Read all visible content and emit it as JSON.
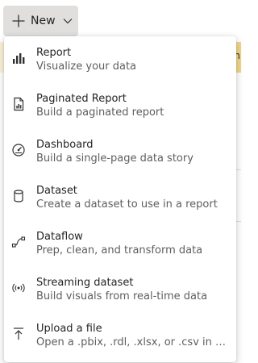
{
  "new_button": {
    "label": "New",
    "plus_icon": "plus-icon",
    "chevron_icon": "chevron-down-icon"
  },
  "background": {
    "banner_fragment": "n"
  },
  "menu": {
    "items": [
      {
        "title": "Report",
        "description": "Visualize your data",
        "icon": "bar-chart-icon"
      },
      {
        "title": "Paginated Report",
        "description": "Build a paginated report",
        "icon": "paginated-report-icon"
      },
      {
        "title": "Dashboard",
        "description": "Build a single-page data story",
        "icon": "dashboard-gauge-icon"
      },
      {
        "title": "Dataset",
        "description": "Create a dataset to use in a report",
        "icon": "database-icon"
      },
      {
        "title": "Dataflow",
        "description": "Prep, clean, and transform data",
        "icon": "dataflow-icon"
      },
      {
        "title": "Streaming dataset",
        "description": "Build visuals from real-time data",
        "icon": "streaming-icon"
      },
      {
        "title": "Upload a file",
        "description": "Open a .pbix, .rdl, .xlsx, or .csv in Po...",
        "icon": "upload-icon"
      }
    ]
  },
  "colors": {
    "button_bg": "#e1dfdd",
    "banner_bg": "#fcf3d7",
    "text_primary": "#252423",
    "text_secondary": "#605e5c"
  }
}
